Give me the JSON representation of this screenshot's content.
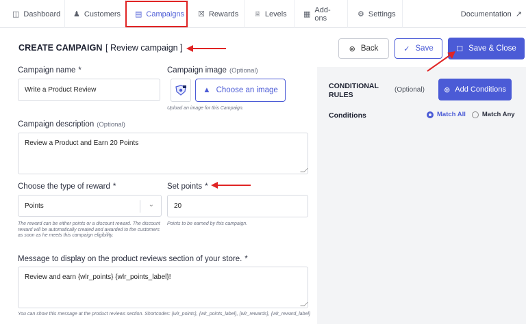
{
  "nav": {
    "items": [
      {
        "label": "Dashboard",
        "icon": "dashboard-icon"
      },
      {
        "label": "Customers",
        "icon": "customers-icon"
      },
      {
        "label": "Campaigns",
        "icon": "campaigns-icon",
        "active": true
      },
      {
        "label": "Rewards",
        "icon": "rewards-icon"
      },
      {
        "label": "Levels",
        "icon": "levels-icon"
      },
      {
        "label": "Add-ons",
        "icon": "addons-icon"
      },
      {
        "label": "Settings",
        "icon": "settings-icon"
      }
    ],
    "documentation": "Documentation"
  },
  "header": {
    "title": "CREATE CAMPAIGN",
    "subtitle": "[ Review campaign ]",
    "back_label": "Back",
    "save_label": "Save",
    "save_close_label": "Save & Close"
  },
  "form": {
    "campaign_name_label": "Campaign name",
    "campaign_name_value": "Write a Product Review",
    "campaign_image_label": "Campaign image",
    "optional_text": "(Optional)",
    "choose_image_label": "Choose an image",
    "image_help": "Upload an image for this Campaign.",
    "description_label": "Campaign description",
    "description_value": "Review a Product and Earn 20 Points",
    "reward_type_label": "Choose the type of reward",
    "reward_type_value": "Points",
    "reward_help": "The reward can be either points or a discount reward. The discount reward will be automatically created and awarded to the customers as soon as he meets this campaign eligibility.",
    "set_points_label": "Set points",
    "set_points_value": "20",
    "points_help": "Points to be earned by this campaign.",
    "message_label": "Message to display on the product reviews section of your store.",
    "message_value": "Review and earn {wlr_points} {wlr_points_label}!",
    "message_help": "You can show this message at the product reviews section. Shortcodes: {wlr_points}, {wlr_points_label}, {wlr_rewards}, {wlr_reward_label}",
    "required_mark": "*"
  },
  "conditions": {
    "title": "CONDITIONAL RULES",
    "optional": "(Optional)",
    "add_label": "Add Conditions",
    "conditions_label": "Conditions",
    "match_all": "Match All",
    "match_any": "Match Any",
    "selected": "Match All"
  },
  "colors": {
    "accent": "#4b5bd6",
    "annotation": "#e02424",
    "panel_bg": "#f3f4f6"
  }
}
